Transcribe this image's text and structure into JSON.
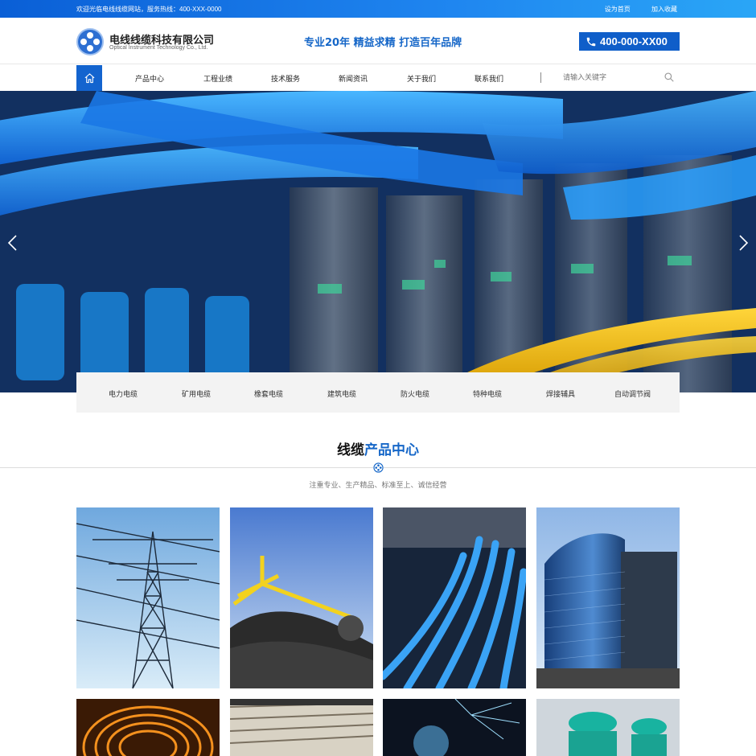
{
  "topbar": {
    "welcome": "欢迎光临电线线缆网站，服务热线：400-XXX-0000",
    "set_home": "设为首页",
    "add_favorite": "加入收藏"
  },
  "header": {
    "brand_cn": "电线线缆科技有限公司",
    "brand_en": "Optical Instrument Technology Co., Ltd.",
    "slogan": "专业20年 精益求精 打造百年品牌",
    "hotline": "400-000-XX00"
  },
  "nav": {
    "items": [
      "产品中心",
      "工程业绩",
      "技术服务",
      "新闻资讯",
      "关于我们",
      "联系我们"
    ],
    "search_placeholder": "请输入关键字"
  },
  "categories": [
    "电力电缆",
    "矿用电缆",
    "橡套电缆",
    "建筑电缆",
    "防火电缆",
    "特种电缆",
    "焊接辅具",
    "自动调节阀"
  ],
  "section": {
    "title_a": "线缆",
    "title_b": "产品中心",
    "subtitle": "注重专业、生产精品、标准至上、诚信经营"
  },
  "colors": {
    "brand_blue": "#1364cf",
    "title_blue": "#1667c8",
    "topbar_start": "#0a5fd6",
    "topbar_end": "#2aa6f6"
  },
  "icons": [
    "home-icon",
    "search-icon",
    "phone-icon",
    "chevron-left-icon",
    "chevron-right-icon",
    "cable-reel-icon"
  ]
}
